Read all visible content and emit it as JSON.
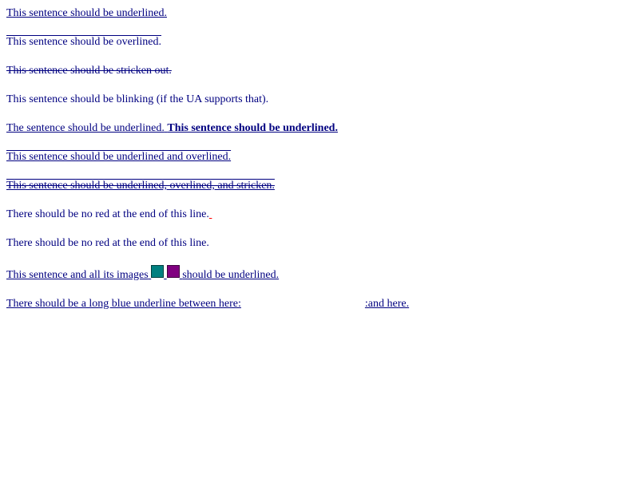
{
  "lines": [
    "This sentence should be underlined.",
    "This sentence should be overlined.",
    "This sentence should be stricken out.",
    "This sentence should be blinking (if the UA supports that).",
    "The sentence should be underlined.",
    "This sentence should be underlined.",
    "This sentence should be underlined and overlined.",
    "This sentence should be underlined, overlined, and stricken.",
    "There should be no red at the end of this line.",
    "There should be no red at the end of this line.",
    "This sentence and all its images",
    "should be underlined.",
    "There should be a long blue underline between here:",
    ":and here."
  ],
  "colors": {
    "text": "#000080",
    "red": "#ff0000",
    "image_teal": "#008080",
    "image_purple": "#800080"
  }
}
